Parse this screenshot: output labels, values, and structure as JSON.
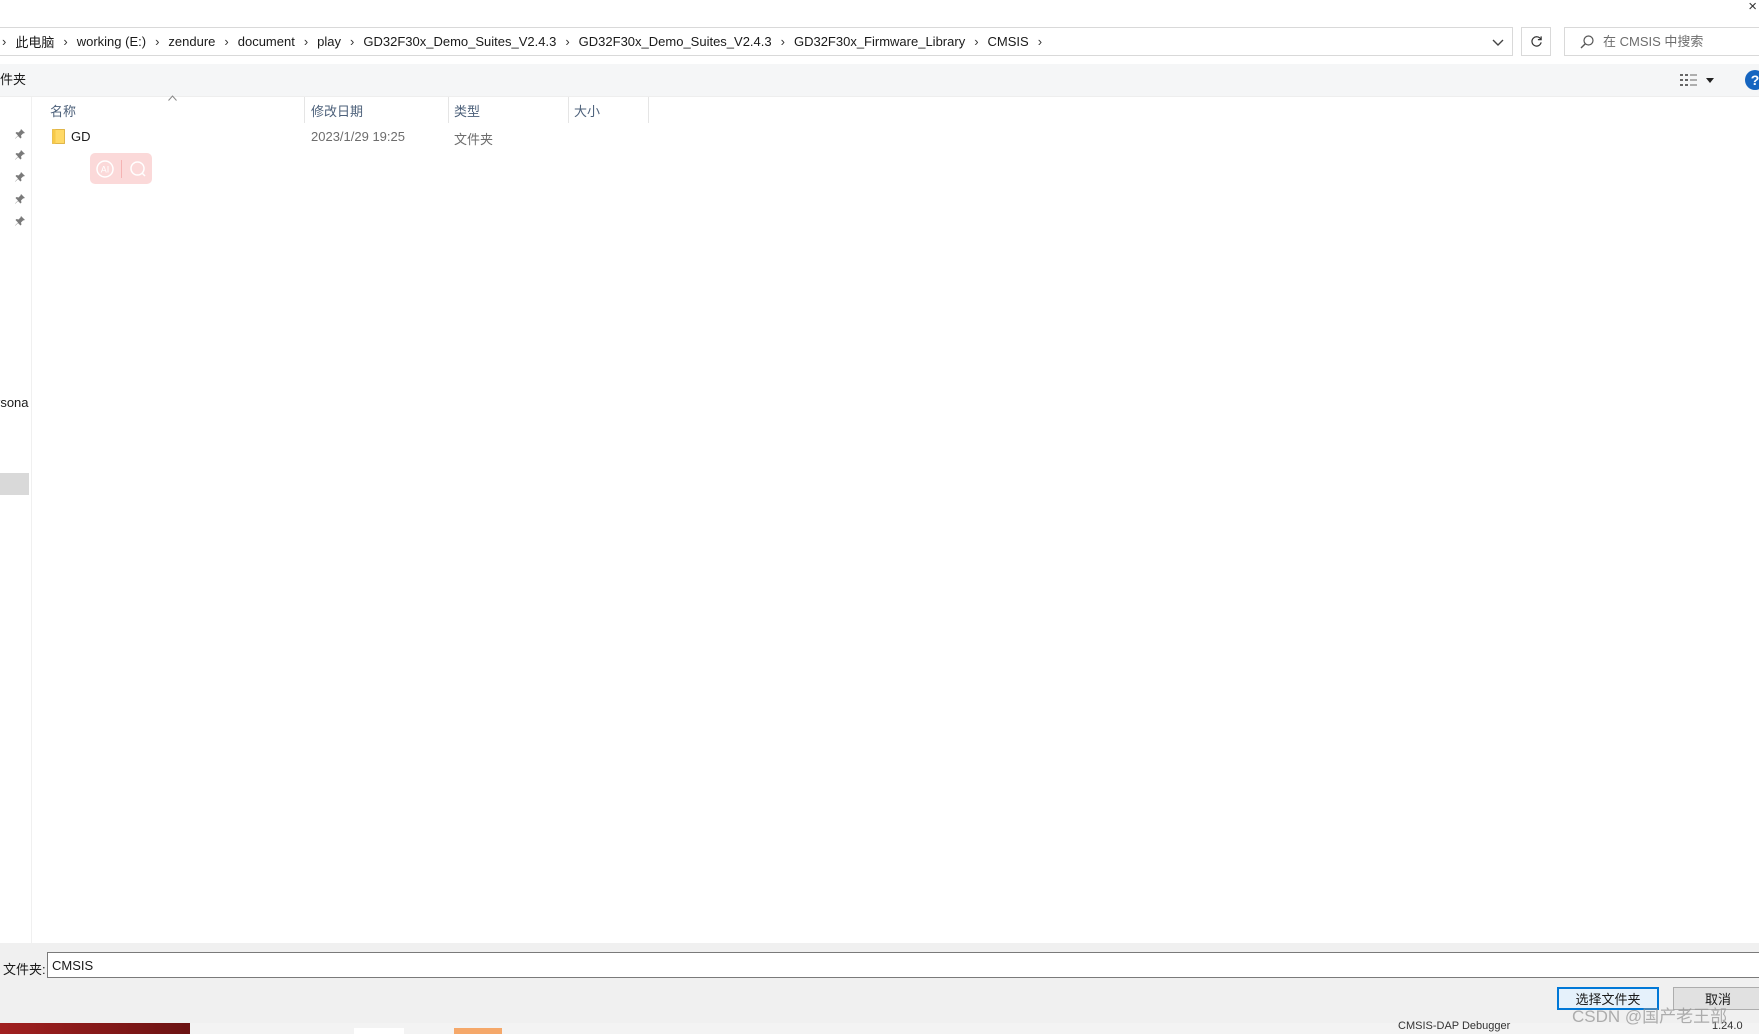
{
  "window": {
    "close_glyph": "×"
  },
  "address_bar": {
    "crumbs": [
      "此电脑",
      "working (E:)",
      "zendure",
      "document",
      "play",
      "GD32F30x_Demo_Suites_V2.4.3",
      "GD32F30x_Demo_Suites_V2.4.3",
      "GD32F30x_Firmware_Library",
      "CMSIS"
    ],
    "separator": "›"
  },
  "search": {
    "placeholder": "在 CMSIS 中搜索",
    "icon": "search-icon"
  },
  "toolbar": {
    "new_folder_label": "件夹",
    "help_label": "?"
  },
  "nav": {
    "personal_label": "rsona"
  },
  "file_list": {
    "columns": {
      "name": "名称",
      "date": "修改日期",
      "type": "类型",
      "size": "大小"
    },
    "rows": [
      {
        "name": "GD",
        "date": "2023/1/29 19:25",
        "type": "文件夹",
        "size": "",
        "icon": "folder-icon"
      }
    ]
  },
  "footer": {
    "folder_label": "文件夹:",
    "folder_value": "CMSIS",
    "select_button": "选择文件夹",
    "cancel_button": "取消"
  },
  "taskbar": {
    "debugger_text": "CMSIS-DAP Debugger",
    "version_text": "1.24.0"
  },
  "watermark": "CSDN @国产老王部",
  "colors": {
    "accent": "#0078d7",
    "help": "#1565c0",
    "pill": "#fbd9d9",
    "folder": "#ffd966"
  }
}
